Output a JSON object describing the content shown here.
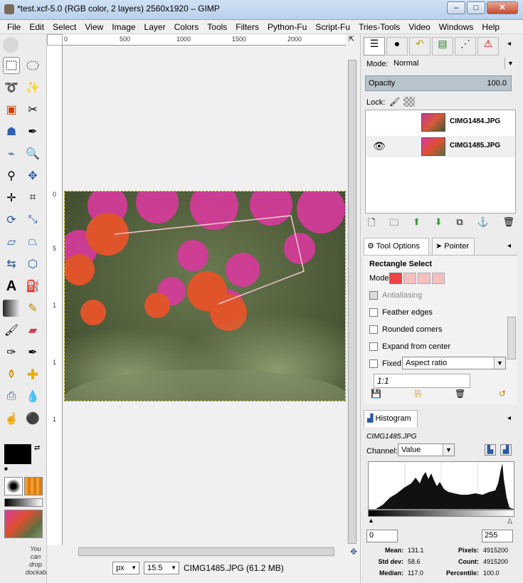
{
  "window": {
    "title": "*test.xcf-5.0 (RGB color, 2 layers) 2560x1920 – GIMP"
  },
  "menu": [
    "File",
    "Edit",
    "Select",
    "View",
    "Image",
    "Layer",
    "Colors",
    "Tools",
    "Filters",
    "Python-Fu",
    "Script-Fu",
    "Tries-Tools",
    "Video",
    "Windows",
    "Help"
  ],
  "ruler": {
    "top": [
      "0",
      "500",
      "1000",
      "1500",
      "2000"
    ],
    "left": [
      "0",
      "5",
      "1",
      "1",
      "1"
    ]
  },
  "status": {
    "unit": "px",
    "zoom": "15.5",
    "file_info": "CIMG1485.JPG (61.2 MB)"
  },
  "toolbox": {
    "drop_hint": "You can drop dockable"
  },
  "layers": {
    "mode_label": "Mode:",
    "mode_value": "Normal",
    "opacity_label": "Opacity",
    "opacity_value": "100.0",
    "lock_label": "Lock:",
    "items": [
      {
        "name": "CIMG1484.JPG",
        "visible": false
      },
      {
        "name": "CIMG1485.JPG",
        "visible": true
      }
    ]
  },
  "tool_options": {
    "tab_active": "Tool Options",
    "tab_other": "Pointer",
    "title": "Rectangle Select",
    "mode_label": "Mode:",
    "antialiasing": "Antialiasing",
    "feather": "Feather edges",
    "rounded": "Rounded corners",
    "expand": "Expand from center",
    "fixed": "Fixed:",
    "fixed_value": "Aspect ratio",
    "ratio": "1:1"
  },
  "histogram": {
    "tab": "Histogram",
    "layer": "CIMG1485.JPG",
    "channel_label": "Channel:",
    "channel_value": "Value",
    "range_low": "0",
    "range_high": "255",
    "stats": {
      "mean_label": "Mean:",
      "mean": "131.1",
      "stddev_label": "Std dev:",
      "stddev": "58.6",
      "median_label": "Median:",
      "median": "117.0",
      "pixels_label": "Pixels:",
      "pixels": "4915200",
      "count_label": "Count:",
      "count": "4915200",
      "percentile_label": "Percentile:",
      "percentile": "100.0"
    }
  }
}
